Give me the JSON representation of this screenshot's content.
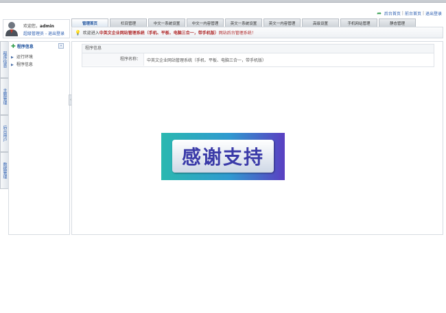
{
  "header": {
    "links": [
      "后台首页",
      "前台首页",
      "退出登录"
    ],
    "separator": "|"
  },
  "user": {
    "welcome_prefix": "欢迎您，",
    "name": "admin",
    "role": "超级管理员",
    "sep": "-",
    "logout": "退出登录"
  },
  "tabs": [
    "管理首页",
    "栏目管理",
    "中文一系统设置",
    "中文一内容管理",
    "英文一系统设置",
    "英文一内容管理",
    "高级设置",
    "手机网站管理",
    "静态管理"
  ],
  "welcome_bar": {
    "prefix": "欢迎进入",
    "system_name": "中英文企业网站管理系统（手机、平板、电脑三合一，带手机版）",
    "suffix": "网站后台管理系统！"
  },
  "side_tabs": [
    "程序信息",
    "主题管理",
    "后台用户",
    "数据管理"
  ],
  "sidebar": {
    "title": "程序信息",
    "collapse_icon": "«",
    "items": [
      "运行环境",
      "程序信息"
    ]
  },
  "panel": {
    "title": "程序信息",
    "label": "程序名称：",
    "value": "中英文企业网站管理系统（手机、平板、电脑三合一，带手机版）"
  },
  "banner": {
    "text": "感谢支持"
  },
  "colors": {
    "link": "#2a5db0",
    "accent_red": "#b02a2a",
    "banner_text": "#3a3aa8"
  }
}
